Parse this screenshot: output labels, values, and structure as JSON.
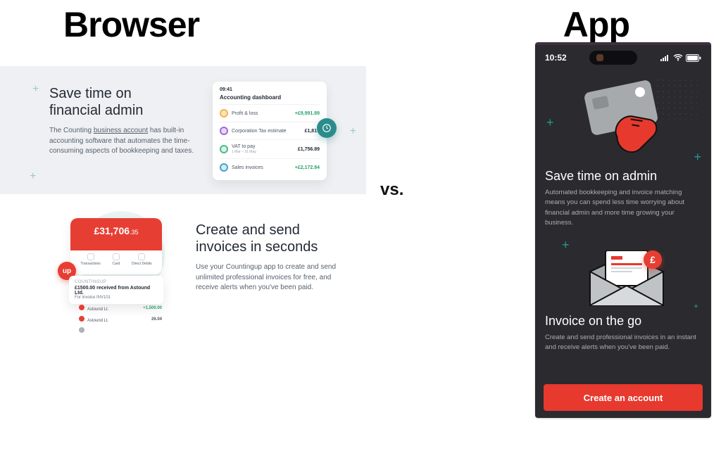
{
  "headings": {
    "browser": "Browser",
    "app": "App",
    "vs": "vs."
  },
  "browser": {
    "feature1": {
      "title": "Save time on\nfinancial admin",
      "body_pre": "The Counting ",
      "body_link": "business account",
      "body_post": " has built-in accounting software that automates the time-consuming aspects of bookkeeping and taxes.",
      "dashboard": {
        "time": "09:41",
        "title": "Accounting dashboard",
        "rows": [
          {
            "label": "Profit & loss",
            "sublabel": "",
            "value": "+£9,991.89",
            "positive": true
          },
          {
            "label": "Corporation Tax estimate",
            "sublabel": "",
            "value": "£1,819",
            "positive": false
          },
          {
            "label": "VAT to pay",
            "sublabel": "1 Mar – 31 May",
            "value": "£1,756.89",
            "positive": false
          },
          {
            "label": "Sales invoices",
            "sublabel": "",
            "value": "+£2,172.84",
            "positive": true
          }
        ]
      }
    },
    "feature2": {
      "title": "Create and send\ninvoices in seconds",
      "body": "Use your Countingup app to create and send unlimited professional invoices for free, and receive alerts when you've been paid.",
      "mock": {
        "balance_main": "£31,706",
        "balance_cents": ".35",
        "tabs": [
          "Transactions",
          "Card",
          "Direct Debits"
        ],
        "toast_tag": "COUNTINGUP",
        "toast_title": "£1500.00 received from Astound Ltd.",
        "toast_sub": "For invoice INV101",
        "up_label": "up",
        "list": [
          {
            "label": "Astound Lt.",
            "value": "+1,500.00"
          },
          {
            "label": "Astound Lt.",
            "value": "26.04"
          }
        ]
      }
    }
  },
  "app": {
    "statusbar": {
      "time": "10:52"
    },
    "section1": {
      "title": "Save time on admin",
      "body": "Automated bookkeeping and invoice matching means you can spend less time worrying about financial admin and more time growing your business."
    },
    "section2": {
      "title": "Invoice on the go",
      "body": "Create and send professional invoices in an instant and receive alerts when you've been paid.",
      "gbp": "£"
    },
    "cta": "Create an account"
  }
}
